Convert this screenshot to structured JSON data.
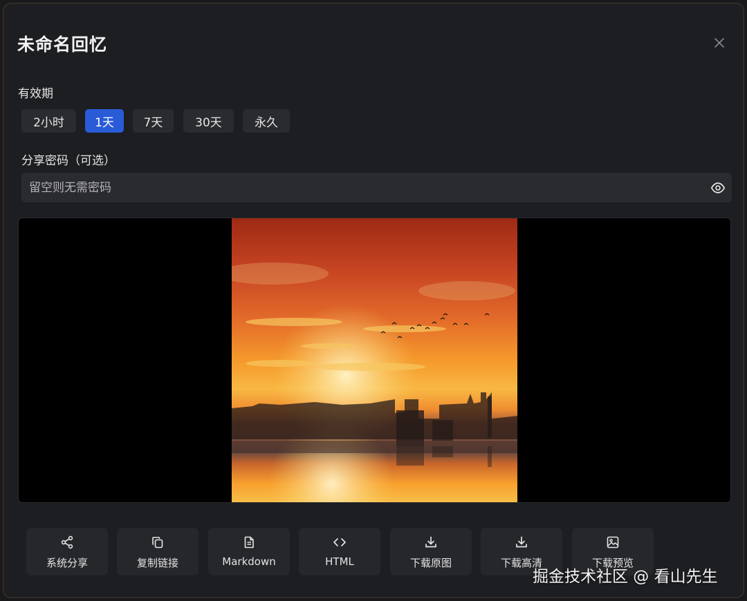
{
  "dialog": {
    "title": "未命名回忆"
  },
  "validity": {
    "label": "有效期",
    "options": [
      "2小时",
      "1天",
      "7天",
      "30天",
      "永久"
    ],
    "selected": "1天"
  },
  "password": {
    "label": "分享密码（可选）",
    "placeholder": "留空则无需密码",
    "value": ""
  },
  "actions": [
    {
      "label": "系统分享",
      "icon": "share-icon"
    },
    {
      "label": "复制链接",
      "icon": "copy-icon"
    },
    {
      "label": "Markdown",
      "icon": "document-icon"
    },
    {
      "label": "HTML",
      "icon": "code-icon"
    },
    {
      "label": "下载原图",
      "icon": "download-icon"
    },
    {
      "label": "下载高清",
      "icon": "download-icon"
    },
    {
      "label": "下载预览",
      "icon": "image-icon"
    }
  ],
  "watermark": "掘金技术社区 @ 看山先生",
  "colors": {
    "accent": "#2a5bd7",
    "background": "#1d1e21",
    "chip": "#2a2b2f"
  }
}
